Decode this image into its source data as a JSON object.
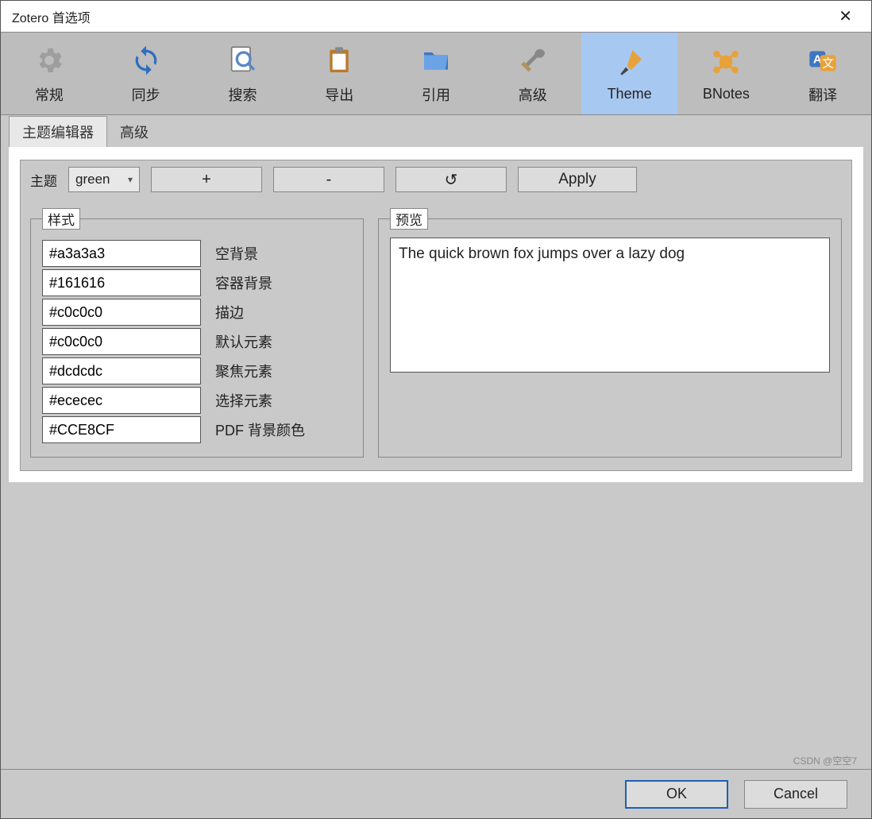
{
  "window": {
    "title": "Zotero 首选项"
  },
  "toolbar": [
    {
      "id": "general",
      "label": "常规",
      "selected": false
    },
    {
      "id": "sync",
      "label": "同步",
      "selected": false
    },
    {
      "id": "search",
      "label": "搜索",
      "selected": false
    },
    {
      "id": "export",
      "label": "导出",
      "selected": false
    },
    {
      "id": "cite",
      "label": "引用",
      "selected": false
    },
    {
      "id": "advanced",
      "label": "高级",
      "selected": false
    },
    {
      "id": "theme",
      "label": "Theme",
      "selected": true
    },
    {
      "id": "bnotes",
      "label": "BNotes",
      "selected": false
    },
    {
      "id": "translate",
      "label": "翻译",
      "selected": false
    }
  ],
  "tabs": [
    {
      "id": "editor",
      "label": "主题编辑器",
      "active": true
    },
    {
      "id": "advanced",
      "label": "高级",
      "active": false
    }
  ],
  "themeRow": {
    "label": "主题",
    "selected": "green",
    "plus": "+",
    "minus": "-",
    "reset": "↺",
    "apply": "Apply"
  },
  "stylesLegend": "样式",
  "previewLegend": "预览",
  "styles": [
    {
      "value": "#a3a3a3",
      "label": "空背景"
    },
    {
      "value": "#161616",
      "label": "容器背景"
    },
    {
      "value": "#c0c0c0",
      "label": "描边"
    },
    {
      "value": "#c0c0c0",
      "label": "默认元素"
    },
    {
      "value": "#dcdcdc",
      "label": "聚焦元素"
    },
    {
      "value": "#ececec",
      "label": "选择元素"
    },
    {
      "value": "#CCE8CF",
      "label": "PDF 背景颜色"
    }
  ],
  "previewText": "The quick brown fox jumps over a lazy dog",
  "footer": {
    "ok": "OK",
    "cancel": "Cancel"
  },
  "watermark": "CSDN @空空7"
}
